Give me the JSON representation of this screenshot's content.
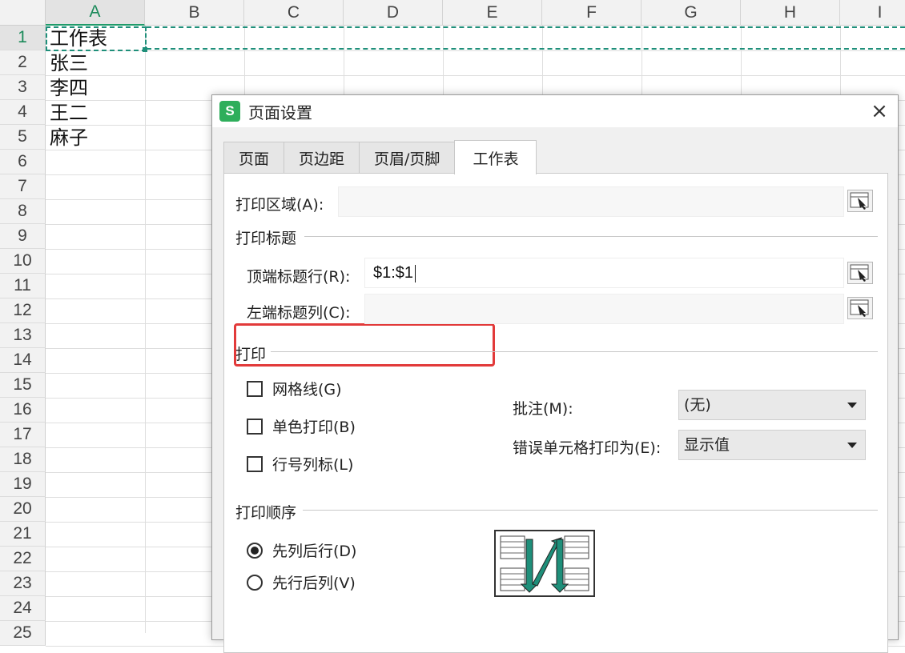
{
  "sheet": {
    "columns": [
      "A",
      "B",
      "C",
      "D",
      "E",
      "F",
      "G",
      "H",
      "I"
    ],
    "selected_column": "A",
    "rows": [
      "1",
      "2",
      "3",
      "4",
      "5",
      "6",
      "7",
      "8",
      "9",
      "10",
      "11",
      "12",
      "13",
      "14",
      "15",
      "16",
      "17",
      "18",
      "19",
      "20",
      "21",
      "22",
      "23",
      "24",
      "25"
    ],
    "selected_row": "1",
    "cells_a": [
      "工作表",
      "张三",
      "李四",
      "王二",
      "麻子"
    ]
  },
  "dialog": {
    "app_icon": "S",
    "title": "页面设置",
    "close_icon": "×",
    "tabs": [
      "页面",
      "页边距",
      "页眉/页脚",
      "工作表"
    ],
    "active_tab": "工作表",
    "print_area_label": "打印区域(A):",
    "print_area_value": "",
    "print_titles_section": "打印标题",
    "top_rows_label": "顶端标题行(R):",
    "top_rows_value": "$1:$1",
    "left_cols_label": "左端标题列(C):",
    "left_cols_value": "",
    "print_section": "打印",
    "checkboxes": [
      {
        "label": "网格线(G)",
        "checked": false
      },
      {
        "label": "单色打印(B)",
        "checked": false
      },
      {
        "label": "行号列标(L)",
        "checked": false
      }
    ],
    "comments_label": "批注(M):",
    "comments_value": "(无)",
    "errors_label": "错误单元格打印为(E):",
    "errors_value": "显示值",
    "order_section": "打印顺序",
    "order_options": [
      {
        "label": "先列后行(D)",
        "selected": true
      },
      {
        "label": "先行后列(V)",
        "selected": false
      }
    ],
    "accent_color": "#1f8f7a",
    "highlight_color": "#e23a3a"
  }
}
